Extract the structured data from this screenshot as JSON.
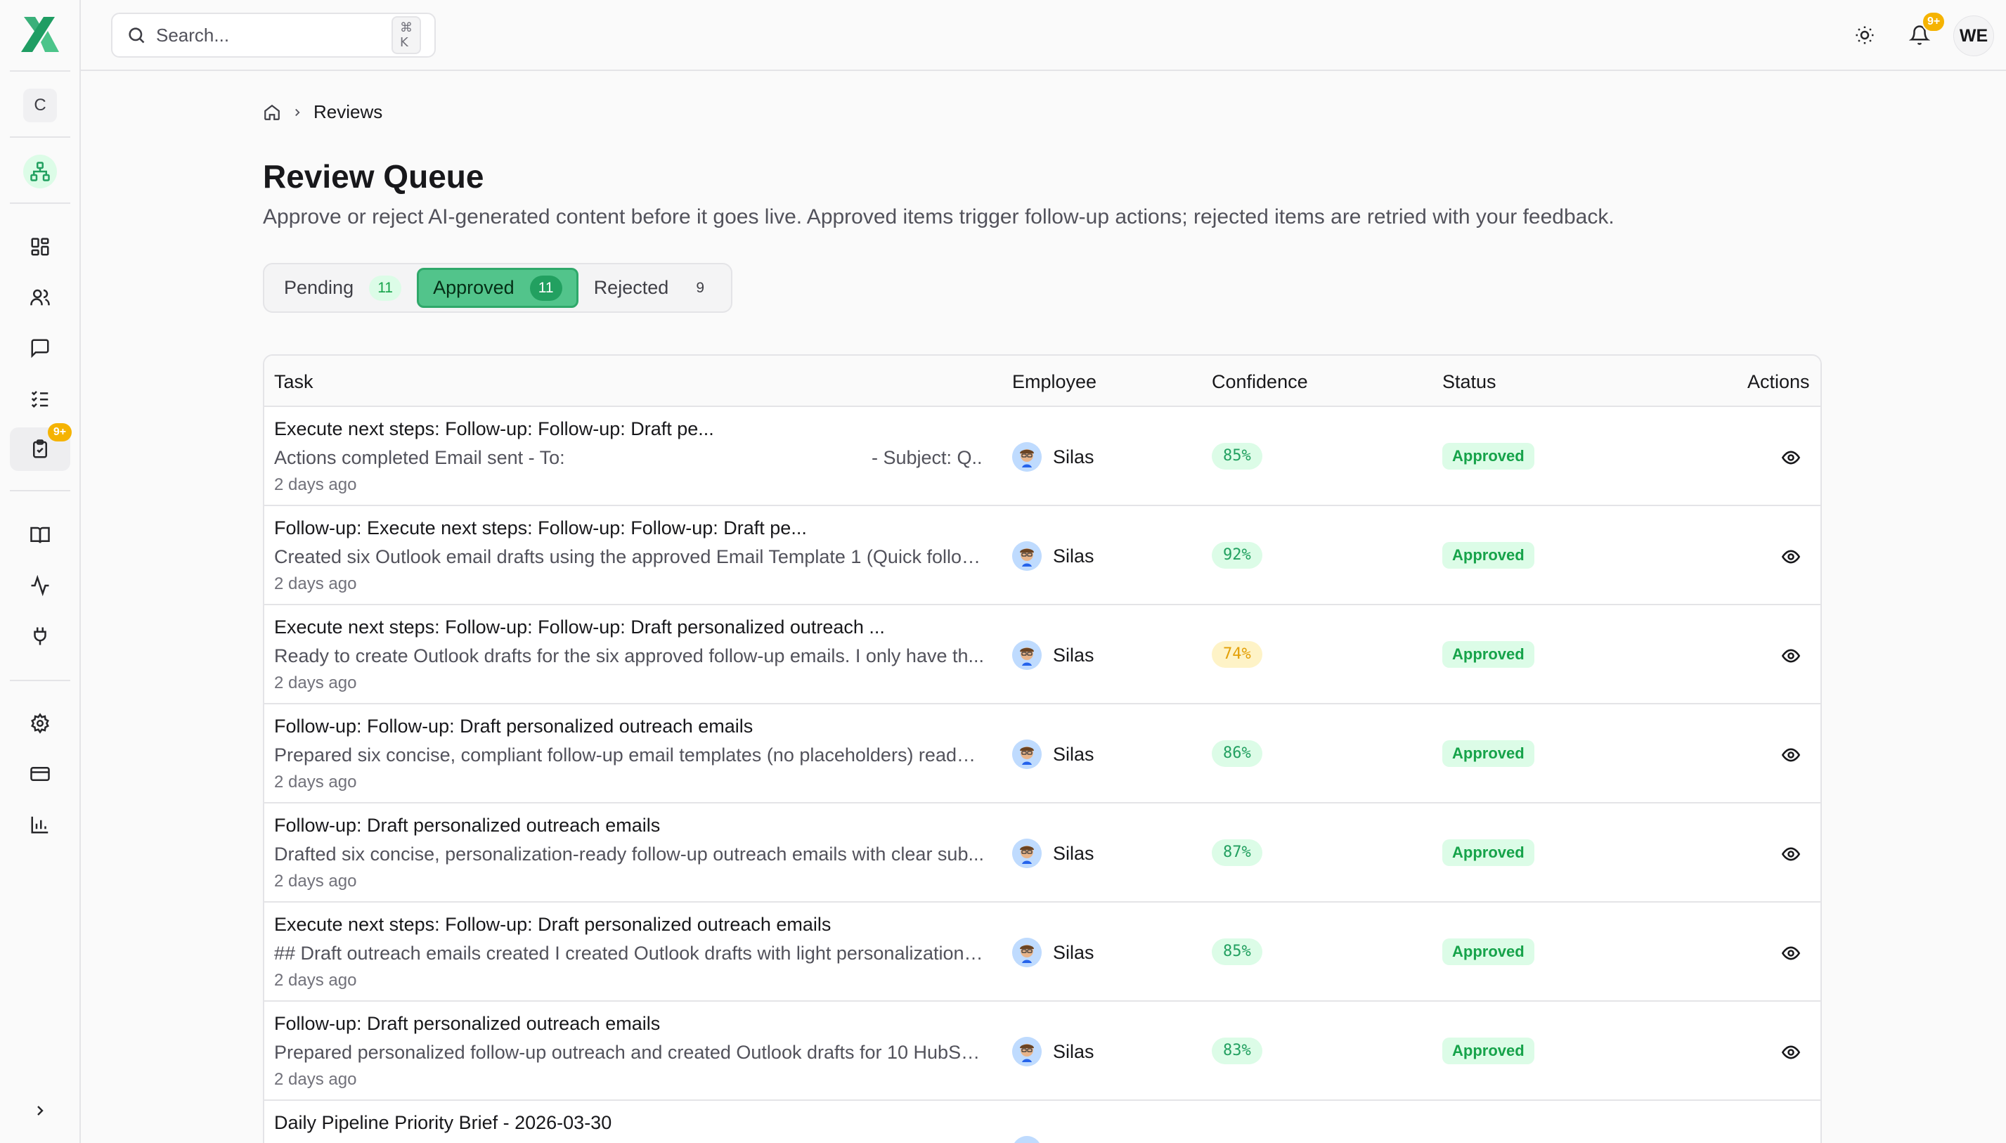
{
  "header": {
    "search_placeholder": "Search...",
    "search_shortcut": "⌘ K",
    "notifications_badge": "9+",
    "user_initials": "WE"
  },
  "sidebar": {
    "workspace_initial": "C",
    "reviews_badge": "9+",
    "items": [
      "dashboard",
      "employees",
      "chat",
      "tasks",
      "reviews",
      "knowledge",
      "activity",
      "integrations",
      "settings",
      "billing",
      "analytics"
    ]
  },
  "breadcrumb": {
    "current": "Reviews"
  },
  "page": {
    "title": "Review Queue",
    "description": "Approve or reject AI-generated content before it goes live. Approved items trigger follow-up actions; rejected items are retried with your feedback."
  },
  "tabs": [
    {
      "label": "Pending",
      "count": "11"
    },
    {
      "label": "Approved",
      "count": "11"
    },
    {
      "label": "Rejected",
      "count": "9"
    }
  ],
  "table": {
    "columns": {
      "task": "Task",
      "employee": "Employee",
      "confidence": "Confidence",
      "status": "Status",
      "actions": "Actions"
    },
    "rows": [
      {
        "title": "Execute next steps: Follow-up: Follow-up: Draft pe...",
        "desc": "Actions completed Email sent - To:",
        "desc_tail": "- Subject: Q...",
        "time": "2 days ago",
        "employee": "Silas",
        "confidence": "85%",
        "status": "Approved"
      },
      {
        "title": "Follow-up: Execute next steps: Follow-up: Follow-up: Draft pe...",
        "desc": "Created six Outlook email drafts using the approved Email Template 1 (Quick follow-...",
        "time": "2 days ago",
        "employee": "Silas",
        "confidence": "92%",
        "status": "Approved"
      },
      {
        "title": "Execute next steps: Follow-up: Follow-up: Draft personalized outreach ...",
        "desc": "Ready to create Outlook drafts for the six approved follow-up emails. I only have th...",
        "time": "2 days ago",
        "employee": "Silas",
        "confidence": "74%",
        "status": "Approved"
      },
      {
        "title": "Follow-up: Follow-up: Draft personalized outreach emails",
        "desc": "Prepared six concise, compliant follow-up email templates (no placeholders) ready ...",
        "time": "2 days ago",
        "employee": "Silas",
        "confidence": "86%",
        "status": "Approved"
      },
      {
        "title": "Follow-up: Draft personalized outreach emails",
        "desc": "Drafted six concise, personalization-ready follow-up outreach emails with clear sub...",
        "time": "2 days ago",
        "employee": "Silas",
        "confidence": "87%",
        "status": "Approved"
      },
      {
        "title": "Execute next steps: Follow-up: Draft personalized outreach emails",
        "desc": "## Draft outreach emails created I created Outlook drafts with light personalization ...",
        "time": "2 days ago",
        "employee": "Silas",
        "confidence": "85%",
        "status": "Approved"
      },
      {
        "title": "Follow-up: Draft personalized outreach emails",
        "desc": "Prepared personalized follow-up outreach and created Outlook drafts for 10 HubSp...",
        "time": "2 days ago",
        "employee": "Silas",
        "confidence": "83%",
        "status": "Approved"
      },
      {
        "title": "Daily Pipeline Priority Brief - 2026-03-30",
        "desc": "",
        "time": "",
        "employee": "",
        "confidence": "",
        "status": ""
      }
    ]
  },
  "colors": {
    "accent": "#52c48b",
    "approved_text": "#16a34a",
    "badge": "#f5b301",
    "confidence_mid": "#e3a008"
  }
}
